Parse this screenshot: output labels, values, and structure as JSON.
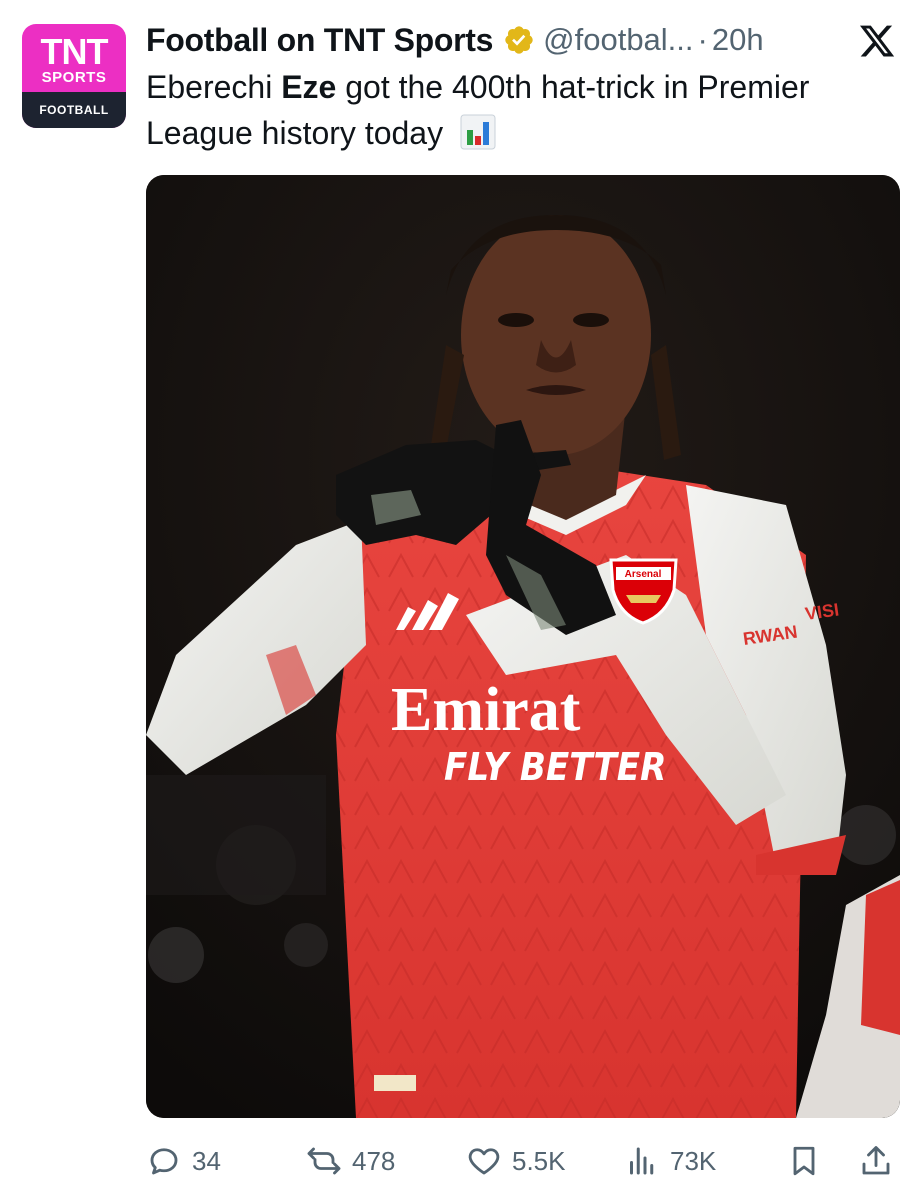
{
  "account": {
    "avatar_text": "TNT",
    "avatar_subtext": "SPORTS",
    "avatar_band": "FOOTBALL",
    "display_name": "Football on TNT Sports",
    "handle": "@footbal...",
    "separator": "·",
    "time": "20h"
  },
  "tweet": {
    "text_before": "Eberechi ",
    "text_bold": "Eze",
    "text_after": " got the 400th hat-trick in Premier League history today"
  },
  "media": {
    "shirt_sponsor": "Emirates",
    "shirt_sponsor_visible": "Emirat",
    "shirt_tagline": "FLY BETTER",
    "badge_text": "Arsenal",
    "sleeve_sponsor_line1": "VISI",
    "sleeve_sponsor_line2": "RWAN"
  },
  "actions": {
    "replies": "34",
    "reposts": "478",
    "likes": "5.5K",
    "views": "73K"
  },
  "colors": {
    "brand_pink": "#ec2fc3",
    "verified_gold": "#e2b719",
    "text_secondary": "#536471",
    "shirt_red": "#e23b3b"
  }
}
